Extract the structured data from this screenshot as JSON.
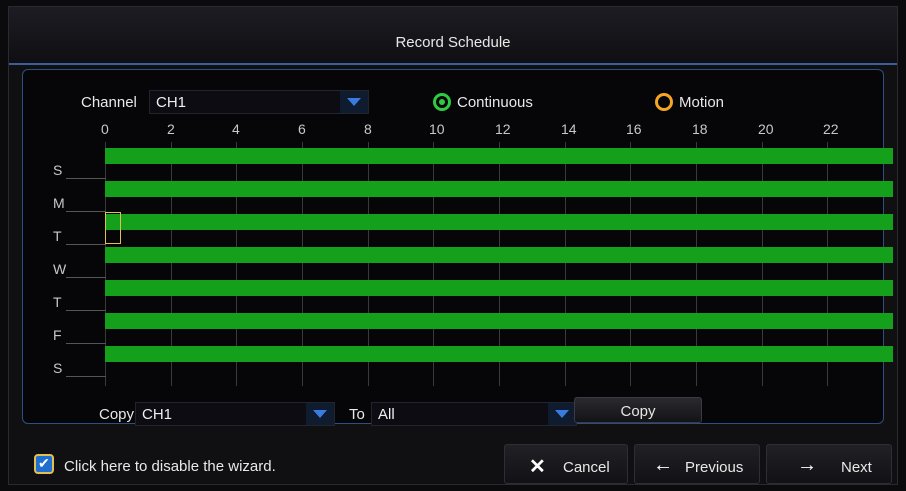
{
  "window": {
    "title": "Record Schedule"
  },
  "channel": {
    "label": "Channel",
    "value": "CH1"
  },
  "mode": {
    "continuous": {
      "label": "Continuous",
      "color": "#2ecc40"
    },
    "motion": {
      "label": "Motion",
      "color": "#f5a623"
    }
  },
  "hours": [
    "0",
    "2",
    "4",
    "6",
    "8",
    "10",
    "12",
    "14",
    "16",
    "18",
    "20",
    "22"
  ],
  "days": [
    "S",
    "M",
    "T",
    "W",
    "T",
    "F",
    "S"
  ],
  "schedule": {
    "fill_color": "#14a01a",
    "mode_all_rows": "continuous"
  },
  "copy": {
    "copy_label": "Copy",
    "from_value": "CH1",
    "to_label": "To",
    "to_value": "All",
    "button_label": "Copy"
  },
  "footer": {
    "wizard_checkbox_label": "Click here to disable the wizard.",
    "wizard_checked": true,
    "cancel_label": "Cancel",
    "previous_label": "Previous",
    "next_label": "Next",
    "cancel_icon": "close-icon",
    "previous_icon": "arrow-left-icon",
    "next_icon": "arrow-right-icon"
  }
}
